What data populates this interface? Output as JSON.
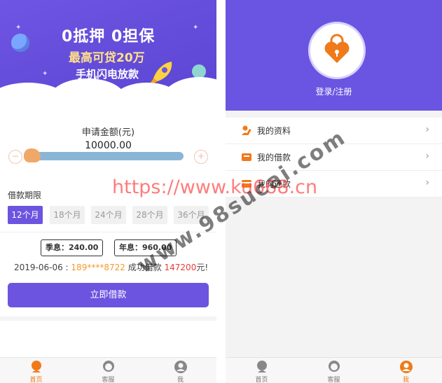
{
  "left": {
    "banner": {
      "line1": "0抵押  0担保",
      "line2": "最高可贷20万",
      "line3": "手机闪电放款"
    },
    "amount_label": "申请金额(元)",
    "amount_value": "10000.00",
    "slider_fraction": 0.05,
    "minus_glyph": "−",
    "plus_glyph": "+",
    "period_label": "借款期限",
    "periods": [
      "12个月",
      "18个月",
      "24个月",
      "28个月",
      "36个月"
    ],
    "selected_period": "12个月",
    "rates": {
      "quarter_label": "季息：",
      "quarter_value": "240.00",
      "year_label": "年息：",
      "year_value": "960.00"
    },
    "marquee": {
      "date": "2019-06-06 : ",
      "phone": "189****8722",
      "mid": " 成功借款 ",
      "amount": "147200",
      "suffix": "元!"
    },
    "apply_button": "立即借款"
  },
  "right": {
    "login_text": "登录/注册",
    "menu": [
      {
        "label": "我的资料",
        "icon": "user-edit-icon"
      },
      {
        "label": "我的借款",
        "icon": "loan-icon"
      },
      {
        "label": "我的还款",
        "icon": "repay-card-icon"
      }
    ],
    "chevron": "›"
  },
  "tabbar": {
    "left": [
      {
        "label": "首页",
        "icon": "home-icon",
        "active": true
      },
      {
        "label": "客服",
        "icon": "service-icon",
        "active": false
      },
      {
        "label": "我",
        "icon": "user-icon",
        "active": false
      }
    ],
    "right": [
      {
        "label": "首页",
        "icon": "home-icon",
        "active": false
      },
      {
        "label": "客服",
        "icon": "service-icon",
        "active": false
      },
      {
        "label": "我",
        "icon": "user-icon",
        "active": true
      }
    ]
  },
  "watermark": {
    "url": "https://www.ku668.cn",
    "site": "www.98sucai.com"
  },
  "colors": {
    "accent": "#6c54e0",
    "active_tab": "#f07a1a",
    "highlight_orange": "#f39a2c",
    "highlight_red": "#ea3a3a"
  }
}
